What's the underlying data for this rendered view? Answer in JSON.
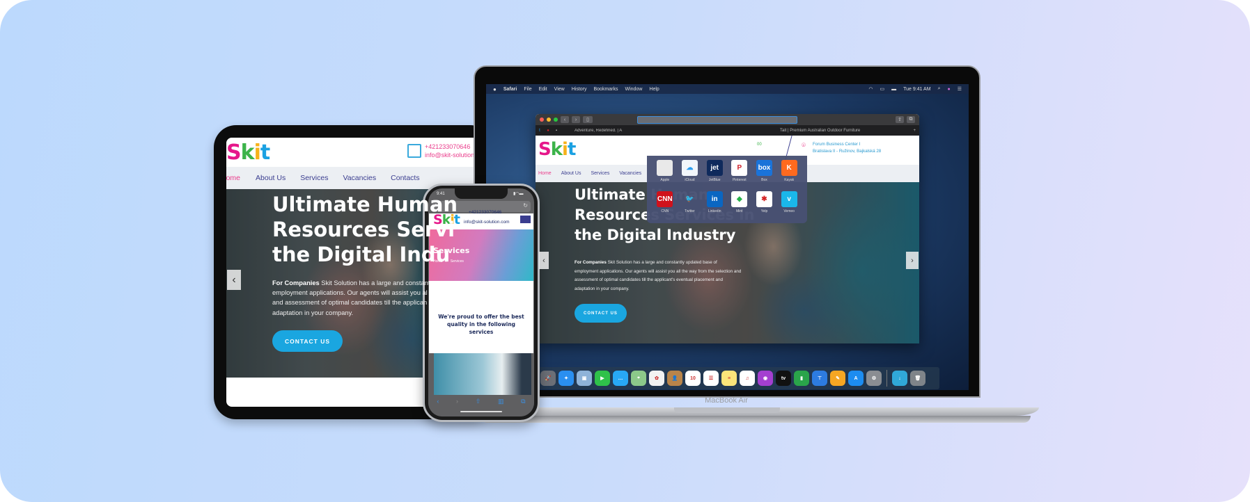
{
  "colors": {
    "accent_blue": "#1aa6e0",
    "nav_text": "#3a3d8f",
    "nav_active": "#ea3c8b",
    "contact_pink": "#ea3c8b",
    "bg_left": "#bcd9fd",
    "bg_right": "#e6e1fb"
  },
  "site": {
    "logo": [
      "S",
      "k",
      "i",
      "t"
    ],
    "nav": [
      "Home",
      "About Us",
      "Services",
      "Vacancies",
      "Contacts"
    ],
    "phone": "+421233070646",
    "email": "info@skit-solution.com",
    "email_cut": "info@skit-solution.c",
    "address_line1": "Forum Business Center I",
    "address_line2": "Bratislava II - Ružinov, Bajkalská 28",
    "header_partial": "00",
    "hero_title_lines": [
      "Ultimate Human",
      "Resources Services in",
      "the Digital Industry"
    ],
    "tablet_title_lines": [
      "Ultimate Human",
      "Resources Servi",
      "the Digital Indu"
    ],
    "hero_lead": "For Companies",
    "hero_text": " Skit Solution has a large and constantly updated base of employment applications. Our agents will assist you all the way from the selection and assessment of optimal candidates till the applicant's eventual placement and adaptation in your company.",
    "tablet_text_lines": [
      " Skit Solution has a large and constant",
      "employment applications. Our agents will assist you al",
      "and assessment of optimal candidates till the applican",
      "adaptation in your company."
    ],
    "cta": "CONTACT US",
    "prev": "‹",
    "next": "›"
  },
  "laptop": {
    "menubar": [
      "Safari",
      "File",
      "Edit",
      "View",
      "History",
      "Bookmarks",
      "Window",
      "Help"
    ],
    "clock": "Tue 9:41 AM",
    "tabs": [
      "Adventure, Redefined. | A",
      "Tait | Premium Australian Outdoor Furniture"
    ],
    "favorites": [
      {
        "label": "Apple",
        "icon": "apple-icon",
        "bg": "#e9e9e9",
        "fg": "#555",
        "glyph": ""
      },
      {
        "label": "iCloud",
        "icon": "icloud-icon",
        "bg": "#f2f6fb",
        "fg": "#2c9ef0",
        "glyph": "☁"
      },
      {
        "label": "JetBlue",
        "icon": "jetblue-icon",
        "bg": "#0f2a5c",
        "fg": "#fff",
        "glyph": "jet"
      },
      {
        "label": "Pinterest",
        "icon": "pinterest-icon",
        "bg": "#fff",
        "fg": "#d0202a",
        "glyph": "P"
      },
      {
        "label": "Box",
        "icon": "box-icon",
        "bg": "#1a73d9",
        "fg": "#fff",
        "glyph": "box"
      },
      {
        "label": "Kayak",
        "icon": "kayak-icon",
        "bg": "#ff6a1f",
        "fg": "#fff",
        "glyph": "K"
      },
      {
        "label": "CNN",
        "icon": "cnn-icon",
        "bg": "#d0111b",
        "fg": "#fff",
        "glyph": "CNN"
      },
      {
        "label": "Twitter",
        "icon": "twitter-icon",
        "bg": "transparent",
        "fg": "#1da1f2",
        "glyph": "🐦"
      },
      {
        "label": "Linkedin",
        "icon": "linkedin-icon",
        "bg": "#0a66c2",
        "fg": "#fff",
        "glyph": "in"
      },
      {
        "label": "Mint",
        "icon": "mint-icon",
        "bg": "#fff",
        "fg": "#27b24a",
        "glyph": "◆"
      },
      {
        "label": "Yelp",
        "icon": "yelp-icon",
        "bg": "#fff",
        "fg": "#d32323",
        "glyph": "✱"
      },
      {
        "label": "Vemeo",
        "icon": "vimeo-icon",
        "bg": "#1ab7ea",
        "fg": "#fff",
        "glyph": "v"
      }
    ],
    "dock": [
      {
        "icon": "launchpad-icon",
        "bg": "#6b6f77",
        "glyph": "🚀"
      },
      {
        "icon": "safari-icon",
        "bg": "#2a8ff0",
        "glyph": "✦"
      },
      {
        "icon": "preview-icon",
        "bg": "#8fb3d8",
        "glyph": "▣"
      },
      {
        "icon": "facetime-icon",
        "bg": "#2fc14a",
        "glyph": "▶"
      },
      {
        "icon": "messages-icon",
        "bg": "#28a8f5",
        "glyph": "…"
      },
      {
        "icon": "maps-icon",
        "bg": "#8cc98a",
        "glyph": "⌖"
      },
      {
        "icon": "photos-icon",
        "bg": "#f2f2f2",
        "glyph": "✿"
      },
      {
        "icon": "contacts-icon",
        "bg": "#b8844a",
        "glyph": "👤"
      },
      {
        "icon": "calendar-icon",
        "bg": "#fff",
        "glyph": "10"
      },
      {
        "icon": "reminders-icon",
        "bg": "#fff",
        "glyph": "☰"
      },
      {
        "icon": "notes-icon",
        "bg": "#fbe57a",
        "glyph": "≡"
      },
      {
        "icon": "music-icon",
        "bg": "#fff",
        "glyph": "♫"
      },
      {
        "icon": "podcasts-icon",
        "bg": "#a43fd0",
        "glyph": "◉"
      },
      {
        "icon": "tv-icon",
        "bg": "#111",
        "glyph": "tv"
      },
      {
        "icon": "numbers-icon",
        "bg": "#2aa44a",
        "glyph": "▮"
      },
      {
        "icon": "keynote-icon",
        "bg": "#2d7be0",
        "glyph": "⊤"
      },
      {
        "icon": "pages-icon",
        "bg": "#f5a623",
        "glyph": "✎"
      },
      {
        "icon": "app-store-icon",
        "bg": "#1c8cf0",
        "glyph": "A"
      },
      {
        "icon": "system-preferences-icon",
        "bg": "#8a8d92",
        "glyph": "⚙"
      },
      {
        "icon": "downloads-folder-icon",
        "bg": "#30a8d8",
        "glyph": "↓"
      },
      {
        "icon": "trash-icon",
        "bg": "#7f8489",
        "glyph": "🗑"
      }
    ],
    "model": "MacBook Air"
  },
  "phone": {
    "time": "9:41",
    "url_aa": "AA",
    "page_title": "Services",
    "breadcrumb": [
      "Home",
      "/",
      "Services"
    ],
    "intro": "We're proud to offer the best quality in the following services"
  }
}
